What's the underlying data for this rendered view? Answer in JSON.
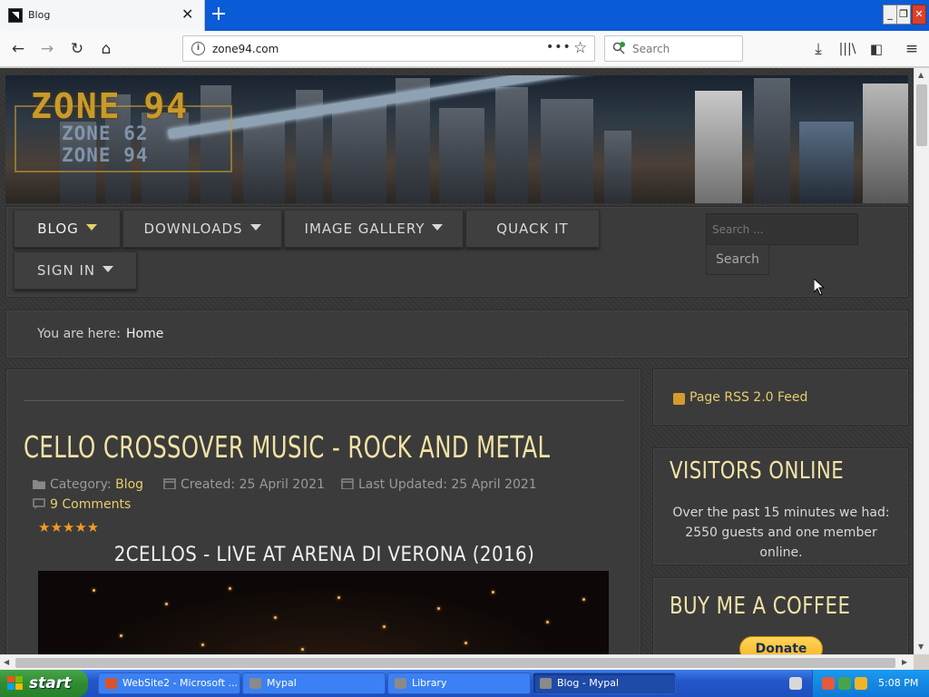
{
  "browser": {
    "tab_title": "Blog",
    "tab_close": "✕",
    "new_tab": "+",
    "url": "zone94.com",
    "url_menu": "•••",
    "search_placeholder": "Search",
    "window_controls": [
      "_",
      "❐",
      "✕"
    ]
  },
  "site": {
    "logo_main": "ZONE 94",
    "logo_sub": [
      "ZONE 62",
      "ZONE 94"
    ],
    "menu": [
      {
        "label": "BLOG",
        "dropdown": true,
        "active": true
      },
      {
        "label": "DOWNLOADS",
        "dropdown": true
      },
      {
        "label": "IMAGE GALLERY",
        "dropdown": true
      },
      {
        "label": "QUACK IT",
        "dropdown": false
      },
      {
        "label": "SIGN IN",
        "dropdown": true
      }
    ],
    "search_placeholder": "Search ...",
    "search_button": "Search",
    "breadcrumb_label": "You are here:",
    "breadcrumb_home": "Home"
  },
  "article": {
    "title": "CELLO CROSSOVER MUSIC - ROCK AND METAL",
    "category_label": "Category:",
    "category": "Blog",
    "created": "Created: 25 April 2021",
    "updated": "Last Updated: 25 April 2021",
    "comments": "9 Comments",
    "stars": "★★★★★",
    "rating": 5,
    "video_title": "2CELLOS - LIVE AT ARENA DI VERONA (2016)"
  },
  "sidebar": {
    "rss": "Page RSS 2.0 Feed",
    "visitors_title": "VISITORS ONLINE",
    "visitors_text": "Over the past 15 minutes we had: 2550 guests and one member online.",
    "coffee_title": "BUY ME A COFFEE",
    "donate": "Donate"
  },
  "taskbar": {
    "start": "start",
    "items": [
      "WebSite2 - Microsoft ...",
      "Mypal",
      "Library",
      "Blog - Mypal"
    ],
    "clock": "5:08 PM"
  },
  "colors": {
    "accent": "#e7cd6b",
    "heading": "#f2e3a6",
    "firefox_tabbar": "#0a5bd6"
  }
}
